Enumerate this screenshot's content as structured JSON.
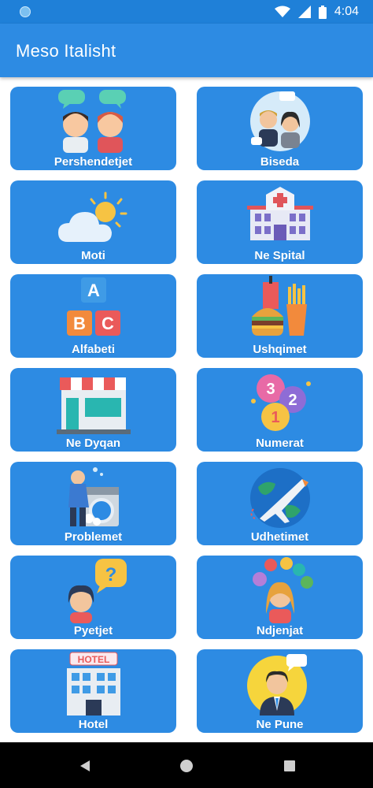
{
  "status": {
    "time": "4:04"
  },
  "app": {
    "title": "Meso Italisht"
  },
  "tiles": [
    {
      "label": "Pershendetjet",
      "icon": "greeting-people-icon"
    },
    {
      "label": "Biseda",
      "icon": "conversation-icon"
    },
    {
      "label": "Moti",
      "icon": "weather-icon"
    },
    {
      "label": "Ne Spital",
      "icon": "hospital-icon"
    },
    {
      "label": "Alfabeti",
      "icon": "alphabet-blocks-icon"
    },
    {
      "label": "Ushqimet",
      "icon": "food-icon"
    },
    {
      "label": "Ne Dyqan",
      "icon": "shop-icon"
    },
    {
      "label": "Numerat",
      "icon": "numbers-icon"
    },
    {
      "label": "Problemet",
      "icon": "laundry-problem-icon"
    },
    {
      "label": "Udhetimet",
      "icon": "travel-plane-icon"
    },
    {
      "label": "Pyetjet",
      "icon": "question-girl-icon"
    },
    {
      "label": "Ndjenjat",
      "icon": "feelings-icon"
    },
    {
      "label": "Hotel",
      "icon": "hotel-icon"
    },
    {
      "label": "Ne Pune",
      "icon": "work-man-icon"
    }
  ],
  "illustration_text": {
    "blocks": [
      "A",
      "B",
      "C"
    ],
    "balls": [
      "3",
      "2",
      "1"
    ],
    "sign": "HOTEL"
  },
  "colors": {
    "primary": "#2d8be3",
    "status_bar": "#1f80d8",
    "nav_bar": "#000000"
  }
}
